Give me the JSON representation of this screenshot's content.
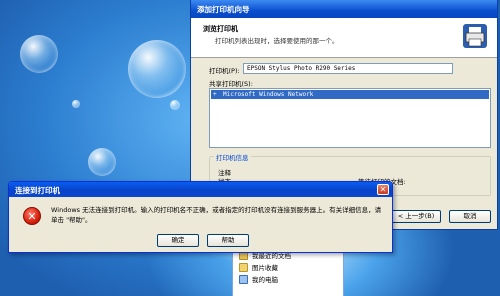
{
  "wizard": {
    "title": "添加打印机向导",
    "heading": "浏览打印机",
    "subheading": "打印机列表出现时，选择要使用的那一个。",
    "printer_label": "打印机(P):",
    "printer_value": "EPSON Stylus Photo R290 Series",
    "shared_label": "共享打印机(S):",
    "shared_items": [
      {
        "label": "Microsoft Windows Network",
        "expander": "+",
        "selected": true
      }
    ],
    "details_group_title": "打印机信息",
    "comment_label": "注释",
    "status_label": "状态",
    "waiting_label": "等待打印的文档:",
    "back_button": "< 上一步(B)",
    "cancel_button": "取消"
  },
  "startmenu": {
    "items": [
      {
        "label": "我最近的文档",
        "icon": "recent-documents-icon"
      },
      {
        "label": "图片收藏",
        "icon": "my-pictures-icon"
      },
      {
        "label": "我的电脑",
        "icon": "my-computer-icon"
      }
    ]
  },
  "error_dialog": {
    "title": "连接到打印机",
    "close_glyph": "✕",
    "icon_glyph": "✕",
    "message": "Windows 无法连接到打印机。输入的打印机名不正确，或者指定的打印机没有连接到服务器上。有关详细信息，请单击 \"帮助\"。",
    "ok_button": "确定",
    "help_button": "帮助"
  },
  "colors": {
    "titlebar": "#0a4fd0",
    "selection": "#316ac5",
    "error_red": "#d8200c"
  }
}
